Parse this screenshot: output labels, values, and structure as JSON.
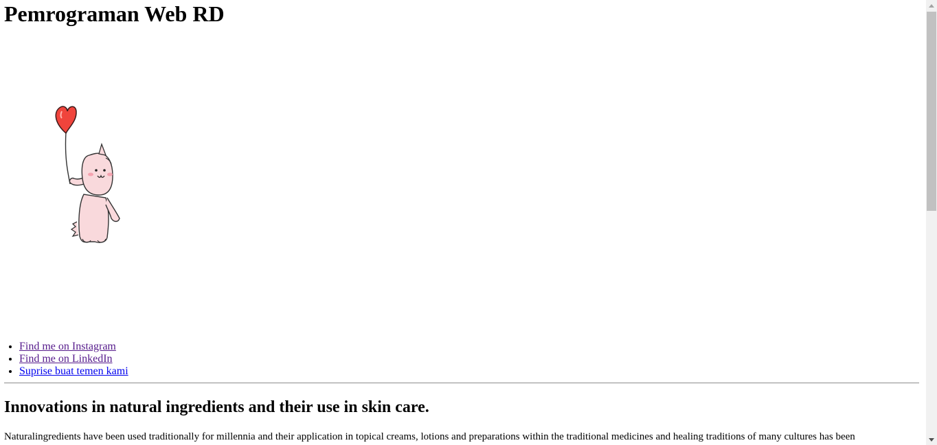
{
  "page": {
    "title": "Pemrograman Web RD"
  },
  "hero": {
    "image_label": "pink dinosaur holding heart balloon"
  },
  "links": [
    {
      "label": "Find me on Instagram",
      "visited": true
    },
    {
      "label": "Find me on LinkedIn",
      "visited": true
    },
    {
      "label": "Suprise buat temen kami",
      "visited": false
    }
  ],
  "article": {
    "heading": "Innovations in natural ingredients and their use in skin care.",
    "body": "Naturalingredients have been used traditionally for millennia and their application in topical creams, lotions and preparations within the traditional medicines and healing traditions of many cultures has been"
  },
  "colors": {
    "visited_link": "#551a8b",
    "unvisited_link": "#0000ee",
    "balloon": "#f0443c",
    "dino_body": "#f9d9dc"
  },
  "icons": {
    "scroll_up": "up-arrow-icon",
    "scroll_down": "down-arrow-icon"
  }
}
